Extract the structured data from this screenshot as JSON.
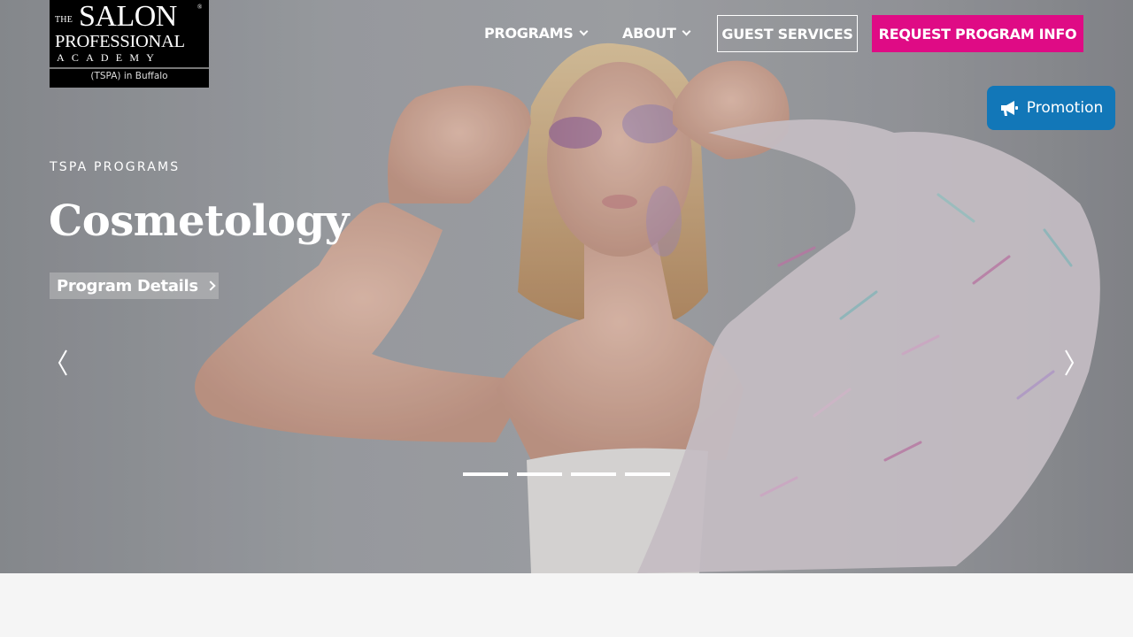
{
  "logo": {
    "the": "THE",
    "salon": "SALON",
    "registered": "®",
    "professional": "PROFESSIONAL",
    "academy": "ACADEMY",
    "location": "(TSPA) in Buffalo"
  },
  "nav": {
    "programs": "PROGRAMS",
    "about": "ABOUT",
    "guest_services": "GUEST SERVICES",
    "request_info": "REQUEST PROGRAM INFO",
    "request_color": "#df0b85"
  },
  "promotion": {
    "label": "Promotion",
    "color": "#1277b8",
    "icon": "megaphone-icon"
  },
  "hero": {
    "eyebrow": "TSPA PROGRAMS",
    "title": "Cosmetology",
    "cta": "Program Details",
    "slides_count": 4,
    "active_slide": 1
  }
}
